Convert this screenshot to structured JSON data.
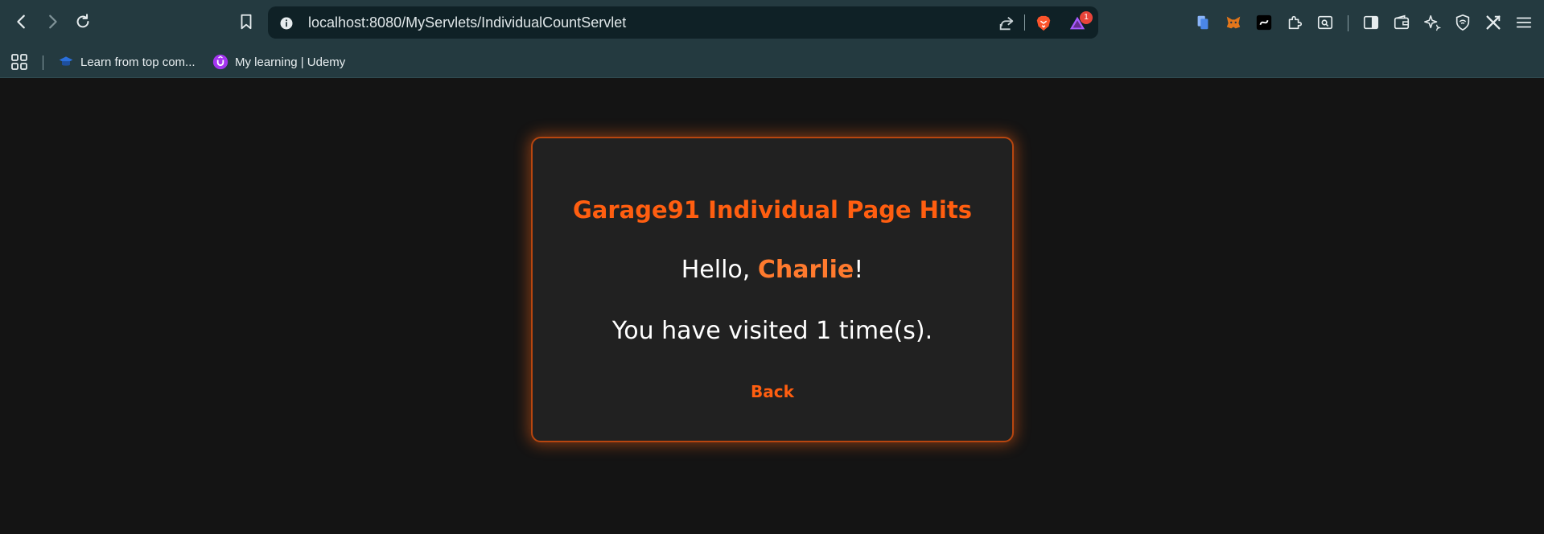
{
  "browser": {
    "url": "localhost:8080/MyServlets/IndividualCountServlet",
    "notification_count": "1",
    "accent_color": "#ff5e10",
    "icons": {
      "back": "chevron-left-icon",
      "forward": "chevron-right-icon",
      "reload": "reload-icon",
      "bookmark": "bookmark-icon",
      "site_info": "info-icon",
      "share": "share-icon",
      "brave_shields": "brave-lion-icon",
      "brave_rewards": "brave-rewards-icon",
      "extensions": [
        "files-extension-icon",
        "metamask-fox-icon",
        "black-extension-icon",
        "puzzle-extensions-icon",
        "screen-search-icon"
      ],
      "sidebar": "sidebar-icon",
      "wallet": "wallet-icon",
      "leo": "leo-sparkle-icon",
      "vpn": "vpn-shield-icon",
      "x_extension": "x-extension-icon",
      "menu": "hamburger-menu-icon"
    }
  },
  "bookmarks": {
    "apps_icon": "apps-grid-icon",
    "items": [
      {
        "label": "Learn from top com...",
        "icon": "course-icon"
      },
      {
        "label": "My learning | Udemy",
        "icon": "udemy-icon"
      }
    ]
  },
  "card": {
    "title": "Garage91 Individual Page Hits",
    "greeting_prefix": "Hello, ",
    "user_name": "Charlie",
    "greeting_suffix": "!",
    "visits_text": "You have visited 1 time(s).",
    "back_label": "Back"
  }
}
